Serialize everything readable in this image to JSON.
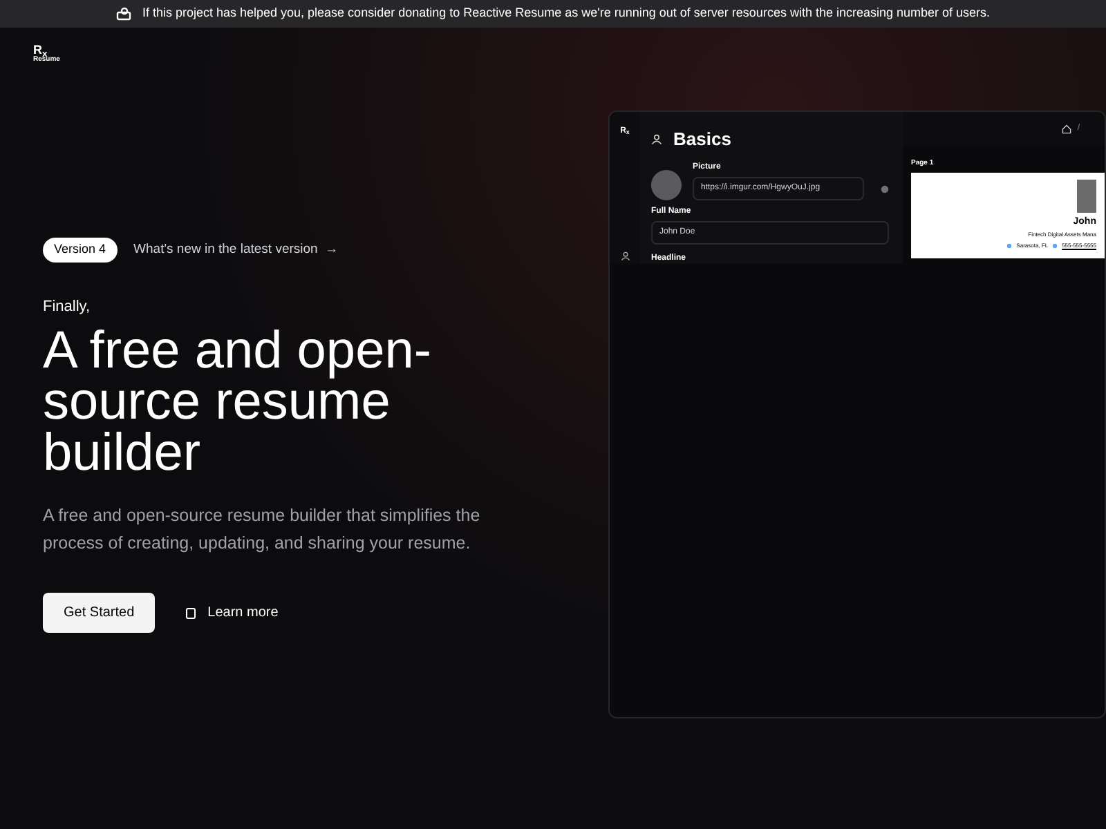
{
  "banner": {
    "text": "If this project has helped you, please consider donating to Reactive Resume as we're running out of server resources with the increasing number of users."
  },
  "logo": {
    "mark": "R$_{x}$",
    "word": "Resume"
  },
  "hero": {
    "badge": "Version 4",
    "whats_new": "What's new in the latest version",
    "arrow": "→",
    "kicker": "Finally,",
    "title": "A free and open-source resume builder",
    "description": "A free and open-source resume builder that simplifies the process of creating, updating, and sharing your resume.",
    "buttons": [
      {
        "kind": "primary",
        "label": "Get Started"
      },
      {
        "kind": "link",
        "label": "Learn more"
      }
    ]
  },
  "preview": {
    "rail_logo": "R$_{x}$",
    "section_title": "Basics",
    "picture_label": "Picture",
    "picture_url": "https://i.imgur.com/HgwyOuJ.jpg",
    "full_name_label": "Full Name",
    "full_name": "John Doe",
    "headline_label": "Headline",
    "breadcrumb_separator": "/",
    "page_label": "Page 1",
    "resume_name": "John",
    "resume_headline": "Fintech Digital Assets Mana",
    "resume_location": "Sarasota, FL",
    "resume_phone": "555-555-5555"
  }
}
